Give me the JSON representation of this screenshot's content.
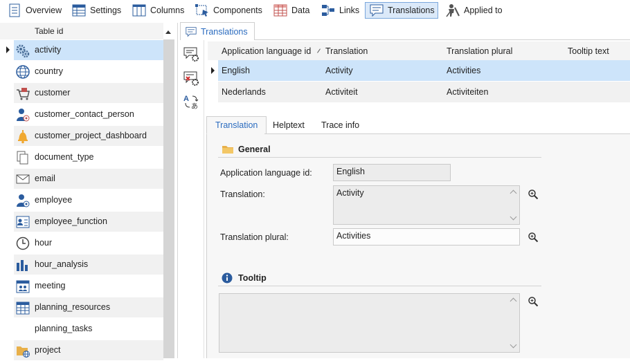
{
  "toolbar": {
    "items": [
      {
        "label": "Overview",
        "icon": "overview-icon"
      },
      {
        "label": "Settings",
        "icon": "settings-table-icon"
      },
      {
        "label": "Columns",
        "icon": "columns-icon"
      },
      {
        "label": "Components",
        "icon": "components-icon"
      },
      {
        "label": "Data",
        "icon": "data-grid-icon"
      },
      {
        "label": "Links",
        "icon": "links-icon"
      },
      {
        "label": "Translations",
        "icon": "translations-icon",
        "active": true
      },
      {
        "label": "Applied to",
        "icon": "applied-to-icon"
      }
    ]
  },
  "table_list": {
    "header": "Table id",
    "items": [
      {
        "label": "activity",
        "icon": "gears-icon",
        "selected": true
      },
      {
        "label": "country",
        "icon": "globe-icon"
      },
      {
        "label": "customer",
        "icon": "shopping-cart-icon"
      },
      {
        "label": "customer_contact_person",
        "icon": "contact-person-icon"
      },
      {
        "label": "customer_project_dashboard",
        "icon": "bell-icon"
      },
      {
        "label": "document_type",
        "icon": "documents-icon"
      },
      {
        "label": "email",
        "icon": "envelope-icon"
      },
      {
        "label": "employee",
        "icon": "employee-icon"
      },
      {
        "label": "employee_function",
        "icon": "id-card-icon"
      },
      {
        "label": "hour",
        "icon": "clock-icon"
      },
      {
        "label": "hour_analysis",
        "icon": "bar-chart-icon"
      },
      {
        "label": "meeting",
        "icon": "calendar-people-icon"
      },
      {
        "label": "planning_resources",
        "icon": "calendar-grid-icon"
      },
      {
        "label": "planning_tasks",
        "icon": ""
      },
      {
        "label": "project",
        "icon": "folder-globe-icon"
      }
    ]
  },
  "main_tab": {
    "label": "Translations"
  },
  "grid": {
    "columns": [
      "Application language id",
      "Translation",
      "Translation plural",
      "Tooltip text"
    ],
    "rows": [
      {
        "language": "English",
        "translation": "Activity",
        "plural": "Activities",
        "tooltip": "",
        "selected": true
      },
      {
        "language": "Nederlands",
        "translation": "Activiteit",
        "plural": "Activiteiten",
        "tooltip": ""
      }
    ]
  },
  "detail_tabs": [
    "Translation",
    "Helptext",
    "Trace info"
  ],
  "form": {
    "general_title": "General",
    "language_label": "Application language id:",
    "language_value": "English",
    "translation_label": "Translation:",
    "translation_value": "Activity",
    "plural_label": "Translation plural:",
    "plural_value": "Activities",
    "tooltip_title": "Tooltip",
    "tooltip_value": ""
  },
  "colors": {
    "selection": "#cde4fa",
    "accent": "#2a6bbf",
    "active_toolbar": "#dbe9f9"
  }
}
